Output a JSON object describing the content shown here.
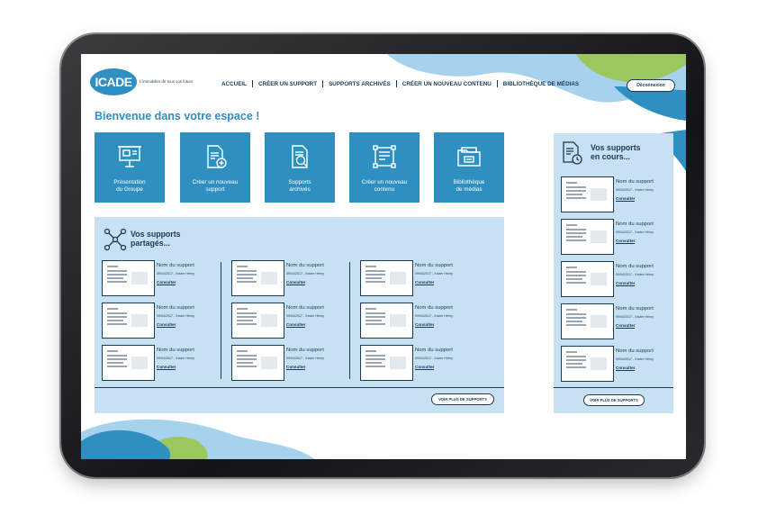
{
  "brand": {
    "logo_text": "ICADE",
    "tagline": "L'immobilier de tous vos futurs"
  },
  "nav": {
    "items": [
      "ACCUEIL",
      "CRÉER UN SUPPORT",
      "SUPPORTS ARCHIVÉS",
      "CRÉER UN NOUVEAU CONTENU",
      "BIBLIOTHÈQUE DE MÉDIAS"
    ],
    "logout": "Déconnexion"
  },
  "welcome": "Bienvenue dans votre espace !",
  "tiles": [
    {
      "label": "Présentation\ndu Groupe",
      "icon": "presentation-board-icon"
    },
    {
      "label": "Créer un nouveau\nsupport",
      "icon": "document-add-icon"
    },
    {
      "label": "Supports\narchivés",
      "icon": "document-search-icon"
    },
    {
      "label": "Créer un nouveau\ncontenu",
      "icon": "layout-edit-icon"
    },
    {
      "label": "Bibliothèque\nde médias",
      "icon": "media-folder-icon"
    }
  ],
  "shared": {
    "title": "Vos supports\npartagés...",
    "icon": "network-share-icon",
    "items": [
      {
        "name": "Nom du support",
        "meta": "09/04/2017 - Xavier Hénry",
        "link": "Consulter"
      },
      {
        "name": "Nom du support",
        "meta": "09/04/2017 - Xavier Hénry",
        "link": "Consulter"
      },
      {
        "name": "Nom du support",
        "meta": "09/04/2017 - Xavier Hénry",
        "link": "Consulter"
      },
      {
        "name": "Nom du support",
        "meta": "09/04/2017 - Xavier Hénry",
        "link": "Consulter"
      },
      {
        "name": "Nom du support",
        "meta": "09/04/2017 - Xavier Hénry",
        "link": "Consulter"
      },
      {
        "name": "Nom du support",
        "meta": "09/04/2017 - Xavier Hénry",
        "link": "Consulter"
      },
      {
        "name": "Nom du support",
        "meta": "09/04/2017 - Xavier Hénry",
        "link": "Consulter"
      },
      {
        "name": "Nom du support",
        "meta": "09/04/2017 - Xavier Hénry",
        "link": "Consulter"
      },
      {
        "name": "Nom du support",
        "meta": "09/04/2017 - Xavier Hénry",
        "link": "Consulter"
      }
    ],
    "more": "VOIR PLUS DE SUPPORTS"
  },
  "inprogress": {
    "title": "Vos supports\nen cours...",
    "icon": "document-clock-icon",
    "items": [
      {
        "name": "Nom du support",
        "meta": "09/04/2017 - Xavier Hénry",
        "link": "Consulter"
      },
      {
        "name": "Nom du support",
        "meta": "09/04/2017 - Xavier Hénry",
        "link": "Consulter"
      },
      {
        "name": "Nom du support",
        "meta": "09/04/2017 - Xavier Hénry",
        "link": "Consulter"
      },
      {
        "name": "Nom du support",
        "meta": "09/04/2017 - Xavier Hénry",
        "link": "Consulter"
      },
      {
        "name": "Nom du support",
        "meta": "09/04/2017 - Xavier Hénry",
        "link": "Consulter"
      }
    ],
    "more": "VOIR PLUS DE SUPPORTS"
  },
  "colors": {
    "primary": "#2f8fc0",
    "navy": "#1b3a5a",
    "panel": "#c7e1f2",
    "green": "#9cc75f",
    "sky": "#a6d2ee"
  }
}
